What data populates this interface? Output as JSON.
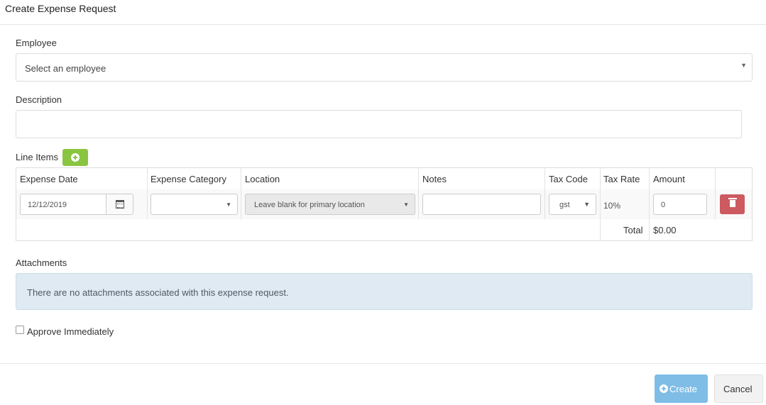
{
  "modal": {
    "title": "Create Expense Request"
  },
  "employee": {
    "label": "Employee",
    "placeholder": "Select an employee"
  },
  "description": {
    "label": "Description",
    "value": ""
  },
  "line_items": {
    "label": "Line Items",
    "columns": [
      "Expense Date",
      "Expense Category",
      "Location",
      "Notes",
      "Tax Code",
      "Tax Rate",
      "Amount"
    ],
    "rows": [
      {
        "expense_date": "12/12/2019",
        "expense_category": "",
        "location_placeholder": "Leave blank for primary location",
        "notes": "",
        "tax_code": "gst",
        "tax_rate": "10%",
        "amount": "0"
      }
    ],
    "total_label": "Total",
    "total_value": "$0.00"
  },
  "attachments": {
    "label": "Attachments",
    "empty_message": "There are no attachments associated with this expense request."
  },
  "approve": {
    "label": "Approve Immediately",
    "checked": false
  },
  "footer": {
    "create_label": "Create",
    "cancel_label": "Cancel"
  },
  "colors": {
    "add_button": "#8ac541",
    "delete_button": "#cc5a60",
    "create_button": "#7fbde6",
    "alert_bg": "#dfeaf2"
  }
}
